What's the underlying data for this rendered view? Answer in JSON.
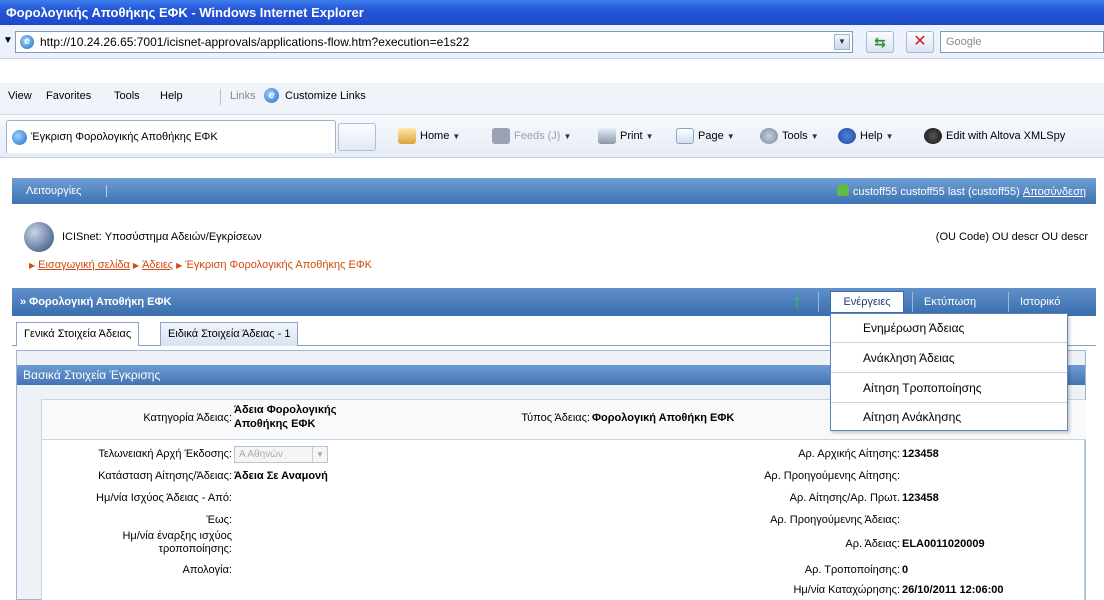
{
  "window": {
    "title": "Φορολογικής Αποθήκης ΕΦΚ - Windows Internet Explorer"
  },
  "address": {
    "url": "http://10.24.26.65:7001/icisnet-approvals/applications-flow.htm?execution=e1s22",
    "search_placeholder": "Google"
  },
  "menubar": {
    "view": "View",
    "favorites": "Favorites",
    "tools": "Tools",
    "help": "Help",
    "links": "Links",
    "customize_links": "Customize Links"
  },
  "browser_tab": {
    "label": "Έγκριση Φορολογικής Αποθήκης ΕΦΚ"
  },
  "commands": {
    "home": "Home",
    "feeds": "Feeds (J)",
    "print": "Print",
    "page": "Page",
    "tools": "Tools",
    "help": "Help",
    "xmlspy": "Edit with Altova XMLSpy"
  },
  "opbar": {
    "operations": "Λειτουργίες",
    "user": "custoff55 custoff55 last (custoff55)",
    "logout": "Αποσύνδεση"
  },
  "header": {
    "system_name": "ICISnet: Υποσύστημα Αδειών/Εγκρίσεων",
    "ou_code": "(OU Code) OU descr OU descr"
  },
  "breadcrumb": {
    "home": "Εισαγωγική σελίδα",
    "licenses": "Άδειες",
    "current": "Έγκριση Φορολογικής Αποθήκης ΕΦΚ"
  },
  "title_bar": {
    "title": "» Φορολογική Αποθήκη ΕΦΚ",
    "actions": "Ενέργειες",
    "print": "Εκτύπωση",
    "history": "Ιστορικό"
  },
  "tabs": {
    "general": "Γενικά Στοιχεία Άδειας",
    "specific": "Ειδικά Στοιχεία Άδειας - 1"
  },
  "panel": {
    "title": "Βασικά Στοιχεία Έγκρισης"
  },
  "form": {
    "category_label": "Κατηγορία Άδειας:",
    "category_value_1": "Άδεια Φορολογικής",
    "category_value_2": "Αποθήκης ΕΦΚ",
    "type_label": "Τύπος Άδειας:",
    "type_value": "Φορολογική Αποθήκη ΕΦΚ",
    "customs_label": "Τελωνειακή Αρχή Έκδοσης:",
    "customs_value": "Α Αθηνών",
    "status_label": "Κατάσταση Αίτησης/Άδειας:",
    "status_value": "Άδεια Σε Αναμονή",
    "valid_from_label": "Ημ/νία Ισχύος Άδειας  -  Από:",
    "valid_to_label": "Έως:",
    "mod_start_label_1": "Ημ/νία έναρξης ισχύος",
    "mod_start_label_2": "τροποποίησης:",
    "justification_label": "Απολογία:",
    "initial_app_label": "Αρ. Αρχικής Αίτησης:",
    "initial_app_value": "123458",
    "prev_app_label": "Αρ. Προηγούμενης Αίτησης:",
    "app_protocol_label": "Αρ. Αίτησης/Αρ. Πρωτ.",
    "app_protocol_value": "123458",
    "prev_license_label": "Αρ. Προηγούμενης Άδειας:",
    "license_no_label": "Αρ. Άδειας:",
    "license_no_value": "ELA0011020009",
    "modification_label": "Αρ. Τροποποίησης:",
    "modification_value": "0",
    "registration_label": "Ημ/νία Καταχώρησης:",
    "registration_value": "26/10/2011 12:06:00"
  },
  "actions_menu": {
    "items": [
      "Ενημέρωση Άδειας",
      "Ανάκληση Άδειας",
      "Αίτηση Τροποποίησης",
      "Αίτηση Ανάκλησης"
    ]
  }
}
